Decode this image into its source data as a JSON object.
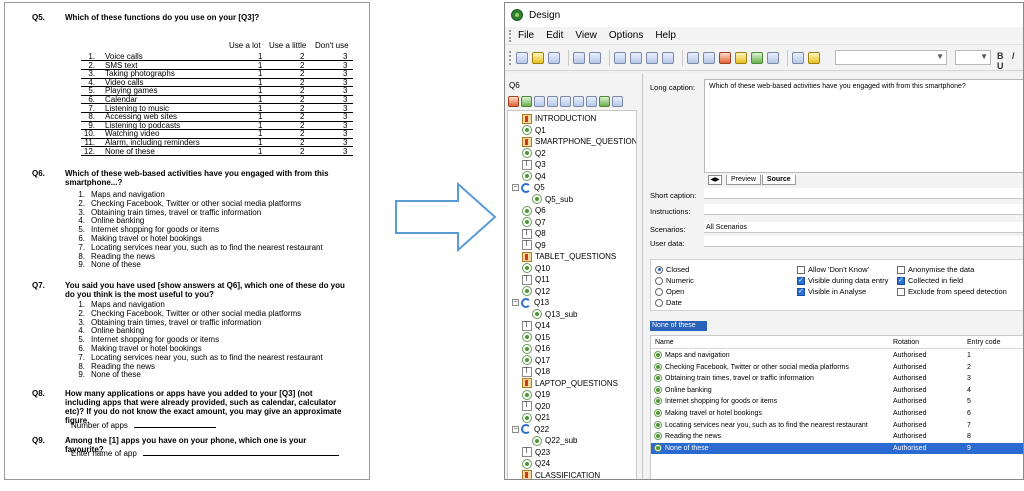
{
  "document": {
    "q5": {
      "num": "Q5.",
      "text": "Which of these functions do you use on your [Q3]?",
      "columns": [
        "Use a lot",
        "Use a little",
        "Don't use"
      ],
      "rows": [
        {
          "n": "1.",
          "label": "Voice calls",
          "c": [
            "1",
            "2",
            "3"
          ]
        },
        {
          "n": "2.",
          "label": "SMS text",
          "c": [
            "1",
            "2",
            "3"
          ]
        },
        {
          "n": "3.",
          "label": "Taking photographs",
          "c": [
            "1",
            "2",
            "3"
          ]
        },
        {
          "n": "4.",
          "label": "Video calls",
          "c": [
            "1",
            "2",
            "3"
          ]
        },
        {
          "n": "5.",
          "label": "Playing games",
          "c": [
            "1",
            "2",
            "3"
          ]
        },
        {
          "n": "6.",
          "label": "Calendar",
          "c": [
            "1",
            "2",
            "3"
          ]
        },
        {
          "n": "7.",
          "label": "Listening to music",
          "c": [
            "1",
            "2",
            "3"
          ]
        },
        {
          "n": "8.",
          "label": "Accessing web sites",
          "c": [
            "1",
            "2",
            "3"
          ]
        },
        {
          "n": "9.",
          "label": "Listening to podcasts",
          "c": [
            "1",
            "2",
            "3"
          ]
        },
        {
          "n": "10.",
          "label": "Watching video",
          "c": [
            "1",
            "2",
            "3"
          ]
        },
        {
          "n": "11.",
          "label": "Alarm, including reminders",
          "c": [
            "1",
            "2",
            "3"
          ]
        },
        {
          "n": "12.",
          "label": "None of these",
          "c": [
            "1",
            "2",
            "3"
          ]
        }
      ]
    },
    "q6": {
      "num": "Q6.",
      "text": "Which of these web-based activities have you engaged with from this smartphone...?",
      "options": [
        "Maps and navigation",
        "Checking Facebook, Twitter or other social media platforms",
        "Obtaining train times, travel or traffic information",
        "Online banking",
        "Internet shopping for goods or items",
        "Making travel or hotel bookings",
        "Locating services near you, such as to find the nearest restaurant",
        "Reading the news",
        "None of these"
      ]
    },
    "q7": {
      "num": "Q7.",
      "text": "You said you have used [show answers at Q6], which one of these do you do you think is the most useful to you?",
      "options": [
        "Maps and navigation",
        "Checking Facebook, Twitter or other social media platforms",
        "Obtaining train times, travel or traffic information",
        "Online banking",
        "Internet shopping for goods or items",
        "Making travel or hotel bookings",
        "Locating services near you, such as to find the nearest restaurant",
        "Reading the news",
        "None of these"
      ]
    },
    "q8": {
      "num": "Q8.",
      "text": "How many applications or apps have you added to your [Q3] (not including apps that were already provided, such as calendar, calculator etc)? If you do not know the exact amount, you may give an approximate figure.",
      "input_label": "Number of apps"
    },
    "q9": {
      "num": "Q9.",
      "text": "Among the [1] apps you have on your phone, which one is your favourite?",
      "input_label": "Enter name of app"
    }
  },
  "design_window": {
    "title": "Design",
    "menu": [
      "File",
      "Edit",
      "View",
      "Options",
      "Help"
    ],
    "left_pane_label": "Q6",
    "tree": [
      {
        "label": "INTRODUCTION",
        "icon": "section",
        "indent": 1
      },
      {
        "label": "Q1",
        "icon": "radio",
        "indent": 1
      },
      {
        "label": "SMARTPHONE_QUESTIONS",
        "icon": "section",
        "indent": 1
      },
      {
        "label": "Q2",
        "icon": "radio",
        "indent": 1
      },
      {
        "label": "Q3",
        "icon": "text",
        "indent": 1
      },
      {
        "label": "Q4",
        "icon": "radio",
        "indent": 1
      },
      {
        "label": "Q5",
        "icon": "loop",
        "indent": 0,
        "expanded": true
      },
      {
        "label": "Q5_sub",
        "icon": "radio",
        "indent": 2
      },
      {
        "label": "Q6",
        "icon": "radio",
        "indent": 1
      },
      {
        "label": "Q7",
        "icon": "radio",
        "indent": 1
      },
      {
        "label": "Q8",
        "icon": "text",
        "indent": 1
      },
      {
        "label": "Q9",
        "icon": "text",
        "indent": 1
      },
      {
        "label": "TABLET_QUESTIONS",
        "icon": "section",
        "indent": 1
      },
      {
        "label": "Q10",
        "icon": "radio",
        "indent": 1
      },
      {
        "label": "Q11",
        "icon": "text",
        "indent": 1
      },
      {
        "label": "Q12",
        "icon": "radio",
        "indent": 1
      },
      {
        "label": "Q13",
        "icon": "loop",
        "indent": 0,
        "expanded": true
      },
      {
        "label": "Q13_sub",
        "icon": "radio",
        "indent": 2
      },
      {
        "label": "Q14",
        "icon": "text",
        "indent": 1
      },
      {
        "label": "Q15",
        "icon": "radio",
        "indent": 1
      },
      {
        "label": "Q16",
        "icon": "radio",
        "indent": 1
      },
      {
        "label": "Q17",
        "icon": "radio",
        "indent": 1
      },
      {
        "label": "Q18",
        "icon": "text",
        "indent": 1
      },
      {
        "label": "LAPTOP_QUESTIONS",
        "icon": "section",
        "indent": 1
      },
      {
        "label": "Q19",
        "icon": "radio",
        "indent": 1
      },
      {
        "label": "Q20",
        "icon": "text",
        "indent": 1
      },
      {
        "label": "Q21",
        "icon": "radio",
        "indent": 1
      },
      {
        "label": "Q22",
        "icon": "loop",
        "indent": 0,
        "expanded": true
      },
      {
        "label": "Q22_sub",
        "icon": "radio",
        "indent": 2
      },
      {
        "label": "Q23",
        "icon": "text",
        "indent": 1
      },
      {
        "label": "Q24",
        "icon": "radio",
        "indent": 1
      },
      {
        "label": "CLASSIFICATION",
        "icon": "section",
        "indent": 1
      }
    ],
    "long_caption_label": "Long caption:",
    "long_caption_value": "Which of these web-based activities have you engaged with from this smartphone?",
    "tab_preview": "Preview",
    "tab_source": "Source",
    "short_caption_label": "Short caption:",
    "instructions_label": "Instructions:",
    "scenarios_label": "Scenarios:",
    "scenarios_value": "All Scenarios",
    "user_data_label": "User data:",
    "types": [
      {
        "label": "Closed",
        "checked": true
      },
      {
        "label": "Numeric",
        "checked": false
      },
      {
        "label": "Open",
        "checked": false
      },
      {
        "label": "Date",
        "checked": false
      }
    ],
    "checks_col1": [
      {
        "label": "Allow 'Don't Know'",
        "checked": false
      },
      {
        "label": "Visible during data entry",
        "checked": true
      },
      {
        "label": "Visible in Analyse",
        "checked": true
      }
    ],
    "checks_col2": [
      {
        "label": "Anonymise the data",
        "checked": false
      },
      {
        "label": "Collected in field",
        "checked": true
      },
      {
        "label": "Exclude from speed detection",
        "checked": false
      }
    ],
    "selected_edit_value": "None of these",
    "grid_headers": [
      "Name",
      "Rotation",
      "Entry code"
    ],
    "grid_rows": [
      {
        "name": "Maps and navigation",
        "rotation": "Authorised",
        "code": "1"
      },
      {
        "name": "Checking Facebook, Twitter or other social media platforms",
        "rotation": "Authorised",
        "code": "2"
      },
      {
        "name": "Obtaining train times, travel or traffic information",
        "rotation": "Authorised",
        "code": "3"
      },
      {
        "name": "Online banking",
        "rotation": "Authorised",
        "code": "4"
      },
      {
        "name": "Internet shopping for goods or items",
        "rotation": "Authorised",
        "code": "5"
      },
      {
        "name": "Making travel or hotel bookings",
        "rotation": "Authorised",
        "code": "6"
      },
      {
        "name": "Locating services near you, such as to find the nearest restaurant",
        "rotation": "Authorised",
        "code": "7"
      },
      {
        "name": "Reading the news",
        "rotation": "Authorised",
        "code": "8"
      },
      {
        "name": "None of these",
        "rotation": "Authorised",
        "code": "9"
      }
    ],
    "selected_row": 8,
    "accent_color": "#2b6ad0",
    "arrow_color": "#5b9bd5"
  }
}
